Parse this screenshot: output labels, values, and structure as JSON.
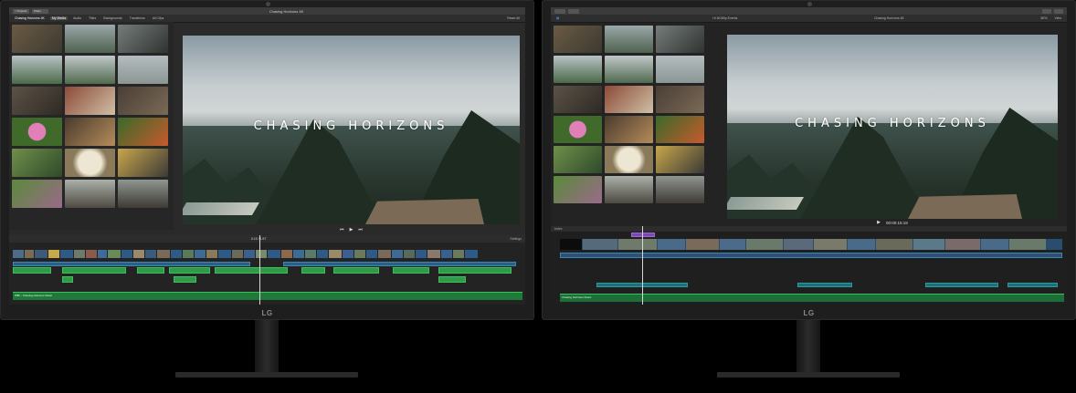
{
  "left": {
    "titlebar": {
      "btn_back": "< Projects",
      "btn_share": "Share",
      "title": "Chasing Horizons 4K"
    },
    "tabs": [
      "My Media",
      "Audio",
      "Titles",
      "Backgrounds",
      "Transitions"
    ],
    "active_tab": "My Media",
    "clip_filter": "All Clips",
    "library_name": "Chasing Horizons 4K",
    "reset_all": "Reset All",
    "viewer_title": "CHASING HORIZONS",
    "timecode": "0:19 / 1:57",
    "settings": "Settings",
    "music_label": "Pffffr - Chasing Horizons Music"
  },
  "right": {
    "titlebar": {
      "title": "Chasing Horizons 4K"
    },
    "browser_label": "Chasing Horizons 4K",
    "event_label": "Hi 4K/60p Events",
    "zoom": "80%",
    "view": "View",
    "viewer_title": "CHASING HORIZONS",
    "timecode": "00:00:15:19",
    "index": "Index",
    "music_label": "Chasing Horizons Music"
  },
  "brand": {
    "logo_left": "LG",
    "logo_right": "LG"
  }
}
